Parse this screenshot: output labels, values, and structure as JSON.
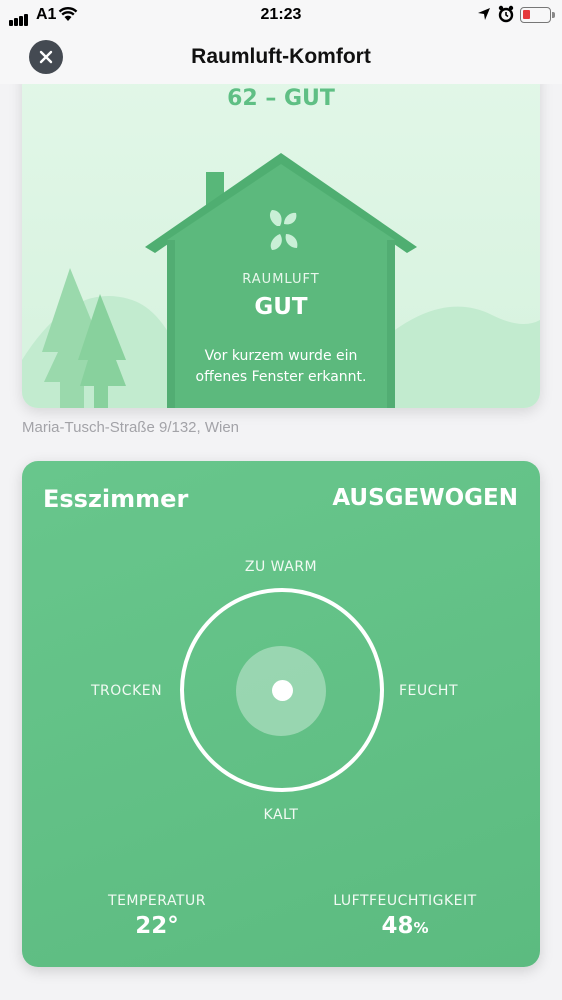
{
  "status_bar": {
    "carrier": "A1",
    "time": "21:23",
    "battery_level_fraction": 0.2,
    "battery_color": "#e5383b"
  },
  "nav": {
    "title": "Raumluft-Komfort",
    "close_icon": "close-icon"
  },
  "air_quality": {
    "score_text": "62 – GUT",
    "label": "RAUMLUFT",
    "status": "GUT",
    "message": "Vor kurzem wurde ein offenes Fenster erkannt.",
    "icon": "leaf-icon",
    "accent_color": "#5fbf84"
  },
  "address": "Maria-Tusch-Straße 9/132, Wien",
  "room": {
    "name": "Esszimmer",
    "status": "AUSGEWOGEN",
    "dial": {
      "top": "ZU WARM",
      "bottom": "KALT",
      "left": "TROCKEN",
      "right": "FEUCHT"
    },
    "temperature": {
      "label": "TEMPERATUR",
      "value": "22°"
    },
    "humidity": {
      "label": "LUFTFEUCHTIGKEIT",
      "value": "48",
      "unit": "%"
    },
    "card_color": "#62c185"
  }
}
